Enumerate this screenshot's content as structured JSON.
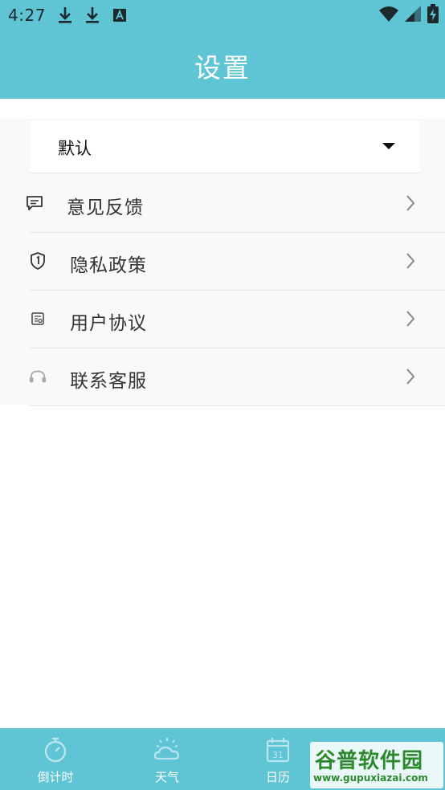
{
  "status_bar": {
    "time": "4:27",
    "left_icons": [
      "download-icon",
      "download-icon",
      "font-badge-icon"
    ],
    "right_icons": [
      "wifi-icon",
      "signal-icon",
      "battery-charging-icon"
    ]
  },
  "header": {
    "title": "设置",
    "background": "#5fc4d4"
  },
  "dropdown": {
    "selected": "默认"
  },
  "menu": {
    "items": [
      {
        "label": "意见反馈",
        "icon": "message-icon"
      },
      {
        "label": "隐私政策",
        "icon": "shield-icon"
      },
      {
        "label": "用户协议",
        "icon": "document-icon"
      },
      {
        "label": "联系客服",
        "icon": "headset-icon"
      }
    ]
  },
  "bottom_nav": {
    "items": [
      {
        "label": "倒计时",
        "icon": "stopwatch-icon"
      },
      {
        "label": "天气",
        "icon": "weather-icon"
      },
      {
        "label": "日历",
        "icon": "calendar-icon",
        "icon_text": "31"
      }
    ]
  },
  "watermark": {
    "logo_text": "谷普软件园",
    "url": "www.gupuxiazai.com"
  }
}
